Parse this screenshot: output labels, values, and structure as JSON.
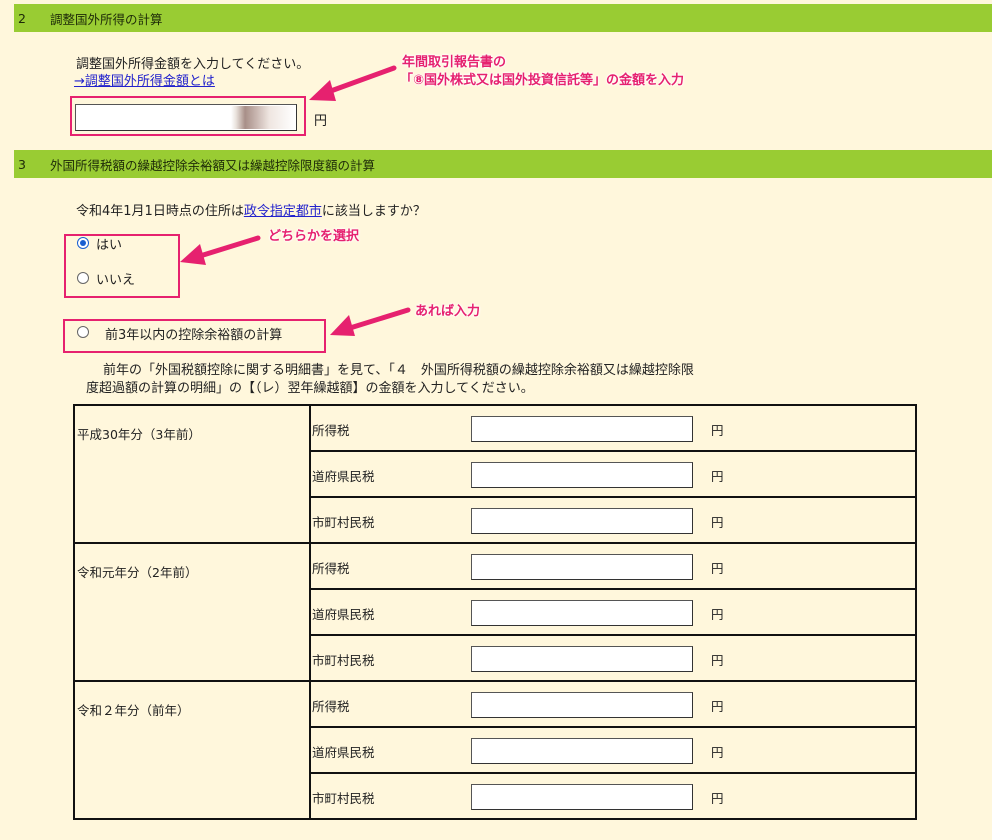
{
  "section2": {
    "number": "2",
    "title": "調整国外所得の計算",
    "instruction": "調整国外所得金額を入力してください。",
    "link_label": "→調整国外所得金額とは",
    "input_value": "",
    "unit": "円"
  },
  "annotations": {
    "top_line1": "年間取引報告書の",
    "top_line2": "「⑧国外株式又は国外投資信託等」の金額を入力",
    "select_one": "どちらかを選択",
    "if_any": "あれば入力"
  },
  "section3": {
    "number": "3",
    "title": "外国所得税額の繰越控除余裕額又は繰越控除限度額の計算",
    "question_prefix": "令和4年1月1日時点の住所は",
    "question_link": "政令指定都市",
    "question_suffix": "に該当しますか？",
    "options": [
      {
        "label": "はい",
        "checked": true
      },
      {
        "label": "いいえ",
        "checked": false
      }
    ],
    "sub_option": {
      "label": "前3年以内の控除余裕額の計算",
      "checked": false
    },
    "explanation_line1": "前年の「外国税額控除に関する明細書」を見て、「４　外国所得税額の繰越控除余裕額又は繰越控除限",
    "explanation_line2": "度超過額の計算の明細」の【（レ）翌年繰越額】の金額を入力してください。",
    "unit": "円",
    "rows": [
      {
        "year": "平成30年分（3年前）",
        "taxes": [
          "所得税",
          "道府県民税",
          "市町村民税"
        ]
      },
      {
        "year": "令和元年分（2年前）",
        "taxes": [
          "所得税",
          "道府県民税",
          "市町村民税"
        ]
      },
      {
        "year": "令和２年分（前年）",
        "taxes": [
          "所得税",
          "道府県民税",
          "市町村民税"
        ]
      }
    ]
  },
  "colors": {
    "background": "#fff7dc",
    "section_bar": "#99cc33",
    "annotation": "#e6216f",
    "link": "#2222cc"
  }
}
